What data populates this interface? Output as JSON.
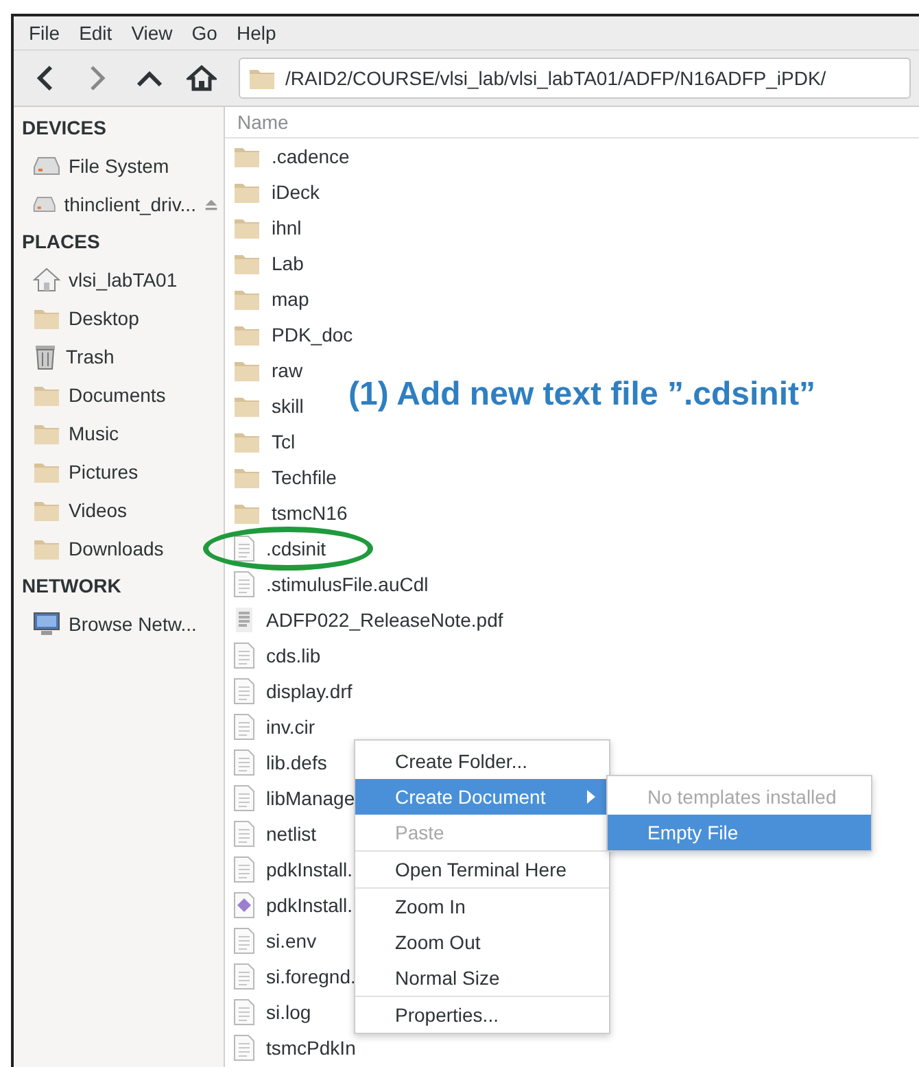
{
  "menu_bar": [
    "File",
    "Edit",
    "View",
    "Go",
    "Help"
  ],
  "toolbar": {
    "location": "/RAID2/COURSE/vlsi_lab/vlsi_labTA01/ADFP/N16ADFP_iPDK/"
  },
  "sidebar": [
    {
      "heading": "DEVICES",
      "items": [
        {
          "label": "File System",
          "kind": "drive"
        },
        {
          "label": "thinclient_driv...",
          "kind": "removable"
        }
      ]
    },
    {
      "heading": "PLACES",
      "items": [
        {
          "label": "vlsi_labTA01",
          "kind": "home"
        },
        {
          "label": "Desktop",
          "kind": "folder"
        },
        {
          "label": "Trash",
          "kind": "trash"
        },
        {
          "label": "Documents",
          "kind": "folder"
        },
        {
          "label": "Music",
          "kind": "folder"
        },
        {
          "label": "Pictures",
          "kind": "folder"
        },
        {
          "label": "Videos",
          "kind": "folder"
        },
        {
          "label": "Downloads",
          "kind": "folder"
        }
      ]
    },
    {
      "heading": "NETWORK",
      "items": [
        {
          "label": "Browse Netw...",
          "kind": "network"
        }
      ]
    }
  ],
  "file_list": {
    "column": "Name",
    "files": [
      {
        "name": ".cadence",
        "kind": "folder"
      },
      {
        "name": "iDeck",
        "kind": "folder"
      },
      {
        "name": "ihnl",
        "kind": "folder"
      },
      {
        "name": "Lab",
        "kind": "folder"
      },
      {
        "name": "map",
        "kind": "folder"
      },
      {
        "name": "PDK_doc",
        "kind": "folder"
      },
      {
        "name": "raw",
        "kind": "folder"
      },
      {
        "name": "skill",
        "kind": "folder"
      },
      {
        "name": "Tcl",
        "kind": "folder"
      },
      {
        "name": "Techfile",
        "kind": "folder"
      },
      {
        "name": "tsmcN16",
        "kind": "folder"
      },
      {
        "name": ".cdsinit",
        "kind": "text",
        "circled": true
      },
      {
        "name": ".stimulusFile.auCdl",
        "kind": "text"
      },
      {
        "name": "ADFP022_ReleaseNote.pdf",
        "kind": "pdf"
      },
      {
        "name": "cds.lib",
        "kind": "text"
      },
      {
        "name": "display.drf",
        "kind": "text"
      },
      {
        "name": "inv.cir",
        "kind": "text"
      },
      {
        "name": "lib.defs",
        "kind": "text"
      },
      {
        "name": "libManage",
        "kind": "text"
      },
      {
        "name": "netlist",
        "kind": "text"
      },
      {
        "name": "pdkInstall.",
        "kind": "text"
      },
      {
        "name": "pdkInstall.",
        "kind": "script"
      },
      {
        "name": "si.env",
        "kind": "text"
      },
      {
        "name": "si.foregnd.",
        "kind": "text"
      },
      {
        "name": "si.log",
        "kind": "text"
      },
      {
        "name": "tsmcPdkIn",
        "kind": "text"
      }
    ]
  },
  "annotation": {
    "text": "(1) Add new text file ”.cdsinit”"
  },
  "context_menu": [
    {
      "label": "Create Folder...",
      "kind": "item",
      "selected": false,
      "separator_after": false
    },
    {
      "label": "Create Document",
      "kind": "submenu",
      "selected": true,
      "separator_after": false
    },
    {
      "label": "Paste",
      "kind": "disabled",
      "selected": false,
      "separator_after": true
    },
    {
      "label": "Open Terminal Here",
      "kind": "item",
      "selected": false,
      "separator_after": true
    },
    {
      "label": "Zoom In",
      "kind": "item",
      "selected": false,
      "separator_after": false
    },
    {
      "label": "Zoom Out",
      "kind": "item",
      "selected": false,
      "separator_after": false
    },
    {
      "label": "Normal Size",
      "kind": "item",
      "selected": false,
      "separator_after": true
    },
    {
      "label": "Properties...",
      "kind": "item",
      "selected": false,
      "separator_after": false
    }
  ],
  "submenu": [
    {
      "label": "No templates installed",
      "kind": "disabled",
      "selected": false
    },
    {
      "label": "Empty File",
      "kind": "item",
      "selected": true
    }
  ]
}
